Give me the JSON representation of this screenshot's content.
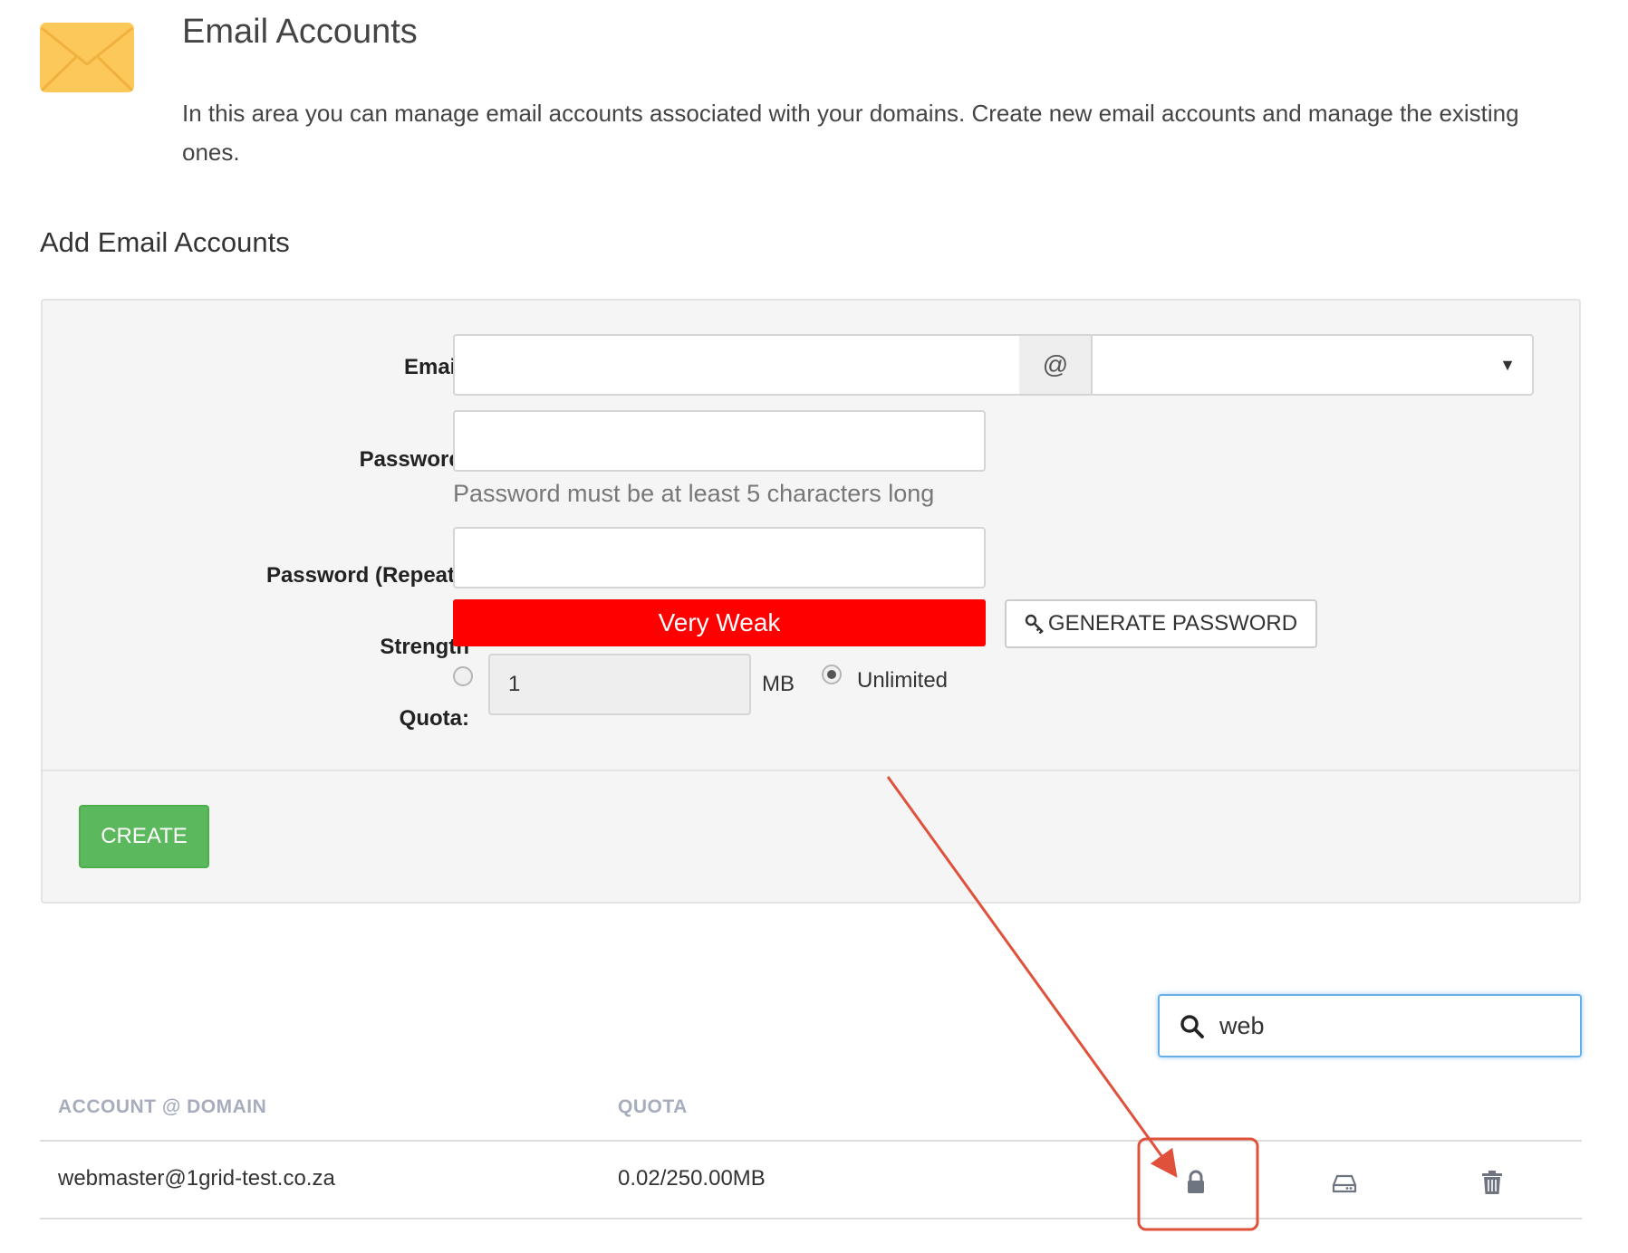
{
  "header": {
    "title": "Email Accounts",
    "description": "In this area you can manage email accounts associated with your domains. Create new email accounts and manage the existing ones."
  },
  "add_section": {
    "title": "Add Email Accounts",
    "labels": {
      "email": "Email:",
      "password": "Password:",
      "password_repeat": "Password (Repeat):",
      "strength": "Strength",
      "quota": "Quota:"
    },
    "email_value": "",
    "at_symbol": "@",
    "domain_selected": "",
    "password_value": "",
    "password_help": "Password must be at least 5 characters long",
    "password_repeat_value": "",
    "strength_text": "Very Weak",
    "generate_button": "GENERATE PASSWORD",
    "quota_value": "1",
    "quota_unit": "MB",
    "unlimited_label": "Unlimited",
    "create_button": "CREATE"
  },
  "search": {
    "value": "web"
  },
  "table": {
    "headers": [
      "ACCOUNT @ DOMAIN",
      "QUOTA"
    ],
    "rows": [
      {
        "account": "webmaster@1grid-test.co.za",
        "quota": "0.02/250.00MB"
      }
    ]
  },
  "colors": {
    "strength_bar": "#ff0000",
    "create_button": "#5cb85c",
    "annotation": "#e0513b",
    "envelope": "#fcc85a"
  },
  "icons": [
    "envelope-icon",
    "key-icon",
    "search-icon",
    "lock-icon",
    "hdd-icon",
    "trash-icon"
  ]
}
